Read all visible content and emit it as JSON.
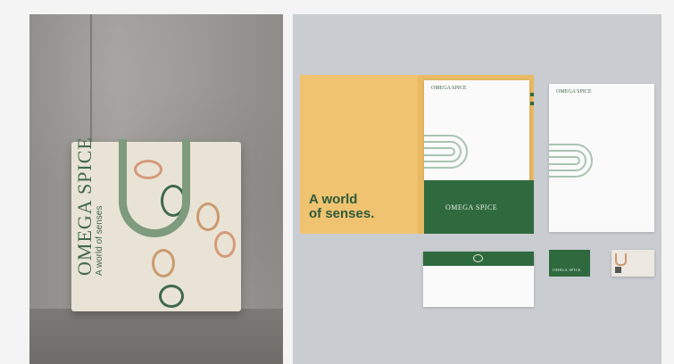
{
  "tote": {
    "brand": "OMEGA SPICE",
    "tagline": "A world of senses",
    "colors": {
      "bag": "#e9e3d6",
      "handle": "#7e9c7d",
      "text": "#3f6a4a"
    }
  },
  "stationery": {
    "slogan_line1": "A world",
    "slogan_line2": "of senses.",
    "folder_logo": "OMEGA SPICE",
    "letterhead_logo_1": "OMEGA SPICE",
    "letterhead_logo_2": "OMEGA SPICE",
    "card_logo": "OMEGA SPICE",
    "colors": {
      "brand_green": "#2f6a3f",
      "folder": "#e9b964",
      "background": "#c9ccd1"
    }
  }
}
